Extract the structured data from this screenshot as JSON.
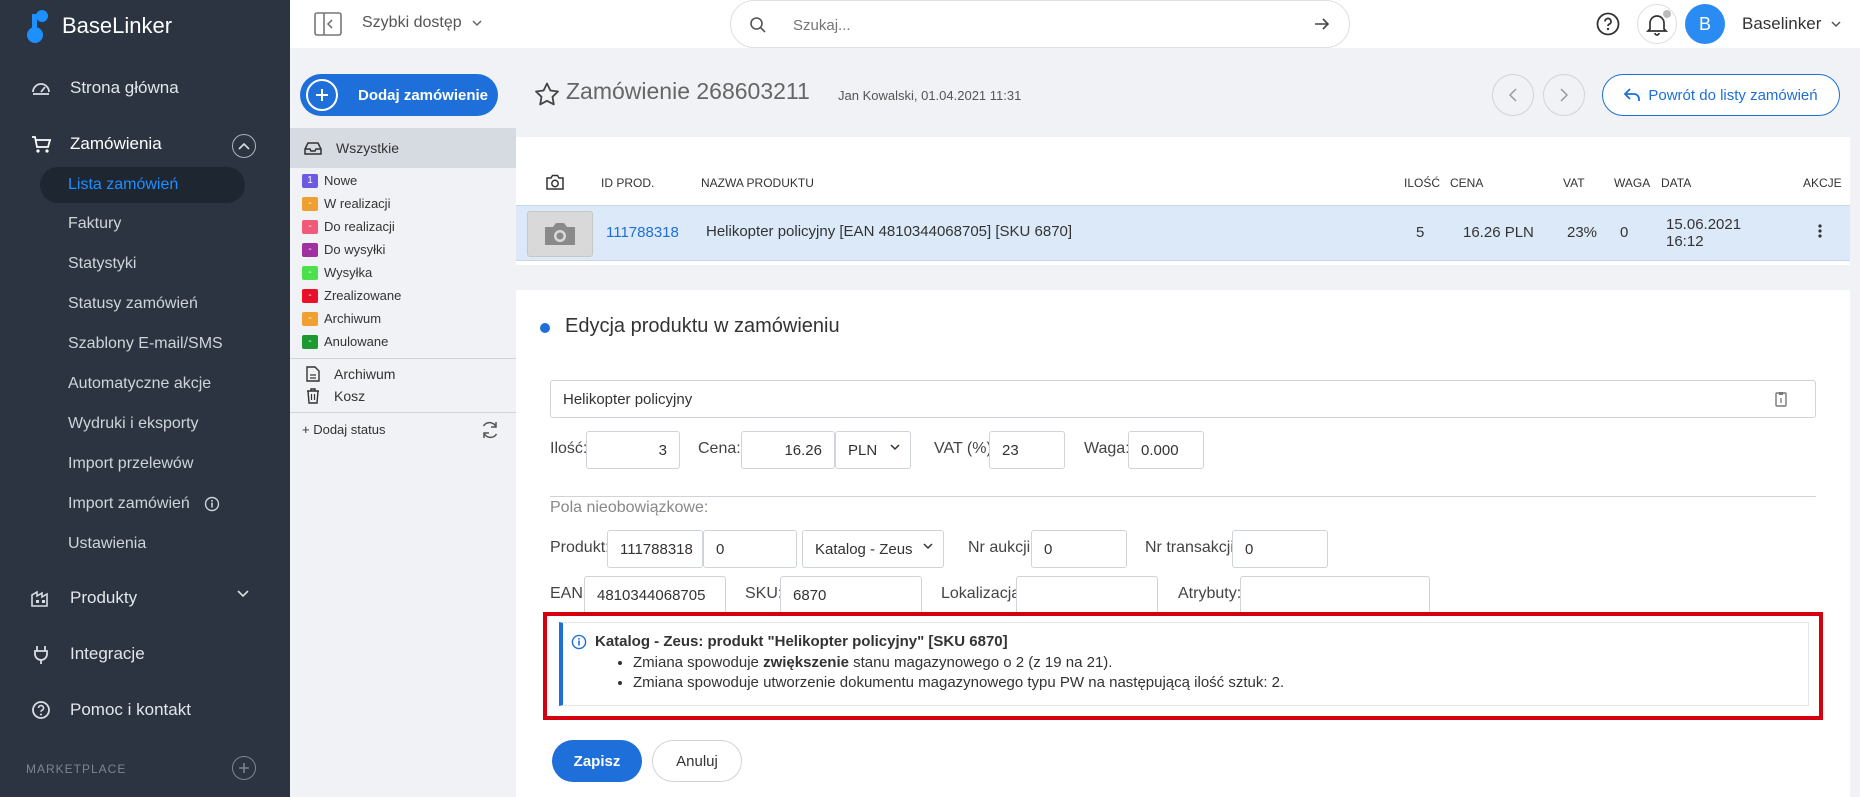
{
  "sidebar": {
    "logo": "BaseLinker",
    "nav": {
      "home": "Strona główna",
      "orders": "Zamówienia",
      "products": "Produkty",
      "integrations": "Integracje",
      "help": "Pomoc i kontakt"
    },
    "orders_sub": [
      "Lista zamówień",
      "Faktury",
      "Statystyki",
      "Statusy zamówień",
      "Szablony E-mail/SMS",
      "Automatyczne akcje",
      "Wydruki i eksporty",
      "Import przelewów",
      "Import zamówień",
      "Ustawienia"
    ],
    "marketplace": "MARKETPLACE"
  },
  "topbar": {
    "quick_access": "Szybki dostęp",
    "search_placeholder": "Szukaj...",
    "user": "Baselinker",
    "avatar_letter": "B"
  },
  "statuses": {
    "add_order": "Dodaj zamówienie",
    "all": "Wszystkie",
    "items": [
      {
        "count": "1",
        "label": "Nowe",
        "color": "#6a5be0"
      },
      {
        "count": "-",
        "label": "W realizacji",
        "color": "#f0a030"
      },
      {
        "count": "-",
        "label": "Do realizacji",
        "color": "#f05a78"
      },
      {
        "count": "-",
        "label": "Do wysyłki",
        "color": "#a030a0"
      },
      {
        "count": "-",
        "label": "Wysyłka",
        "color": "#4de04d"
      },
      {
        "count": "-",
        "label": "Zrealizowane",
        "color": "#e8102a"
      },
      {
        "count": "-",
        "label": "Archiwum",
        "color": "#f0a030"
      },
      {
        "count": "-",
        "label": "Anulowane",
        "color": "#1a9a30"
      }
    ],
    "archive": "Archiwum",
    "trash": "Kosz",
    "add_status": "+ Dodaj status"
  },
  "order": {
    "title": "Zamówienie 268603211",
    "meta": "Jan Kowalski, 01.04.2021 11:31",
    "back": "Powrót do listy zamówień"
  },
  "table": {
    "headers": {
      "id": "ID PROD.",
      "name": "NAZWA PRODUKTU",
      "qty": "ILOŚĆ",
      "price": "CENA",
      "vat": "VAT",
      "weight": "WAGA",
      "date": "DATA",
      "actions": "AKCJE"
    },
    "row": {
      "id": "111788318",
      "name": "Helikopter policyjny [EAN 4810344068705] [SKU 6870]",
      "qty": "5",
      "price": "16.26 PLN",
      "vat": "23%",
      "weight": "0",
      "date_line1": "15.06.2021",
      "date_line2": "16:12"
    }
  },
  "edit": {
    "title": "Edycja produktu w zamówieniu",
    "name": "Helikopter policyjny",
    "qty_label": "Ilość:",
    "qty": "3",
    "price_label": "Cena:",
    "price": "16.26",
    "currency": "PLN",
    "vat_label": "VAT (%):",
    "vat": "23",
    "weight_label": "Waga:",
    "weight": "0.000",
    "optional_label": "Pola nieobowiązkowe:",
    "product_label": "Produkt:",
    "product_id": "111788318",
    "variant": "0",
    "catalog": "Katalog - Zeus",
    "auction_label": "Nr aukcji:",
    "auction": "0",
    "transaction_label": "Nr transakcji:",
    "transaction": "0",
    "ean_label": "EAN:",
    "ean": "4810344068705",
    "sku_label": "SKU:",
    "sku": "6870",
    "location_label": "Lokalizacja:",
    "location": "",
    "attributes_label": "Atrybuty:",
    "attributes": ""
  },
  "info": {
    "title": "Katalog - Zeus: produkt \"Helikopter policyjny\" [SKU 6870]",
    "line1_pre": "Zmiana spowoduje ",
    "line1_bold": "zwiększenie",
    "line1_post": " stanu magazynowego o 2 (z 19 na 21).",
    "line2": "Zmiana spowoduje utworzenie dokumentu magazynowego typu PW na następującą ilość sztuk: 2."
  },
  "buttons": {
    "save": "Zapisz",
    "cancel": "Anuluj"
  }
}
